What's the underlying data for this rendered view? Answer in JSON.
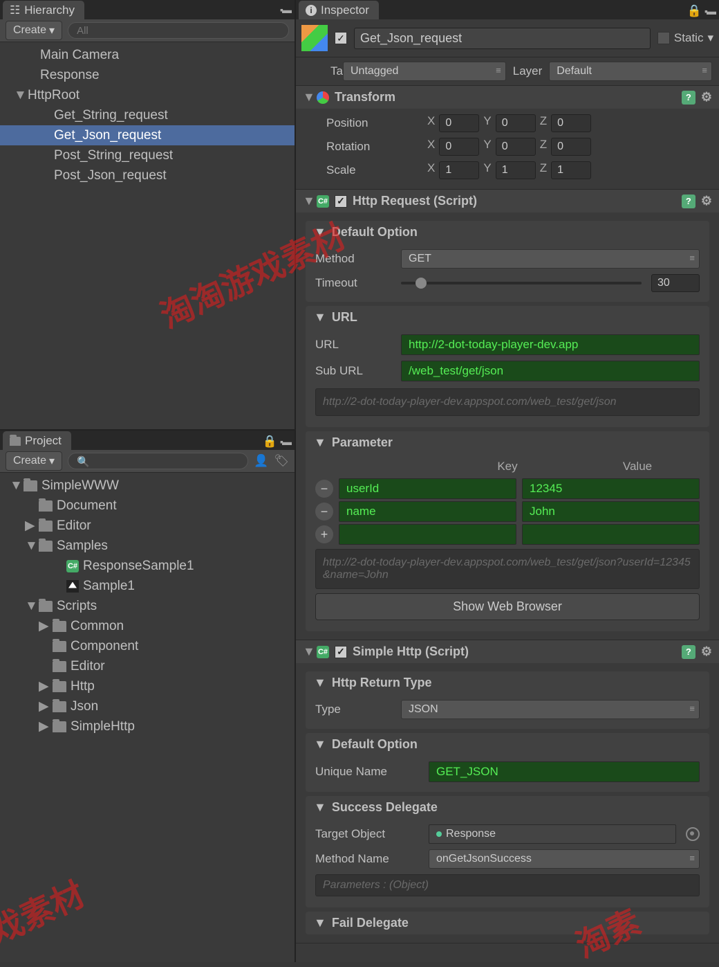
{
  "hierarchy": {
    "tab_label": "Hierarchy",
    "create_label": "Create",
    "search_placeholder": "All",
    "items": [
      {
        "label": "Main Camera",
        "indent": 1,
        "arrow": ""
      },
      {
        "label": "Response",
        "indent": 1,
        "arrow": ""
      },
      {
        "label": "HttpRoot",
        "indent": 0,
        "arrow": "▼"
      },
      {
        "label": "Get_String_request",
        "indent": 2,
        "arrow": ""
      },
      {
        "label": "Get_Json_request",
        "indent": 2,
        "arrow": "",
        "selected": true
      },
      {
        "label": "Post_String_request",
        "indent": 2,
        "arrow": ""
      },
      {
        "label": "Post_Json_request",
        "indent": 2,
        "arrow": ""
      }
    ]
  },
  "project": {
    "tab_label": "Project",
    "create_label": "Create",
    "items": [
      {
        "label": "SimpleWWW",
        "indent": 1,
        "arrow": "▼",
        "icon": "folder"
      },
      {
        "label": "Document",
        "indent": 2,
        "arrow": "",
        "icon": "folder"
      },
      {
        "label": "Editor",
        "indent": 2,
        "arrow": "▶",
        "icon": "folder"
      },
      {
        "label": "Samples",
        "indent": 2,
        "arrow": "▼",
        "icon": "folder"
      },
      {
        "label": "ResponseSample1",
        "indent": 4,
        "arrow": "",
        "icon": "cs"
      },
      {
        "label": "Sample1",
        "indent": 4,
        "arrow": "",
        "icon": "unity"
      },
      {
        "label": "Scripts",
        "indent": 2,
        "arrow": "▼",
        "icon": "folder"
      },
      {
        "label": "Common",
        "indent": 3,
        "arrow": "▶",
        "icon": "folder"
      },
      {
        "label": "Component",
        "indent": 3,
        "arrow": "",
        "icon": "folder"
      },
      {
        "label": "Editor",
        "indent": 3,
        "arrow": "",
        "icon": "folder"
      },
      {
        "label": "Http",
        "indent": 3,
        "arrow": "▶",
        "icon": "folder"
      },
      {
        "label": "Json",
        "indent": 3,
        "arrow": "▶",
        "icon": "folder"
      },
      {
        "label": "SimpleHttp",
        "indent": 3,
        "arrow": "▶",
        "icon": "folder"
      }
    ]
  },
  "inspector": {
    "tab_label": "Inspector",
    "object_name": "Get_Json_request",
    "static_label": "Static",
    "tag_label": "Tag",
    "tag_value": "Untagged",
    "layer_label": "Layer",
    "layer_value": "Default",
    "transform": {
      "title": "Transform",
      "position_label": "Position",
      "position": {
        "x": "0",
        "y": "0",
        "z": "0"
      },
      "rotation_label": "Rotation",
      "rotation": {
        "x": "0",
        "y": "0",
        "z": "0"
      },
      "scale_label": "Scale",
      "scale": {
        "x": "1",
        "y": "1",
        "z": "1"
      }
    },
    "http_request": {
      "title": "Http Request (Script)",
      "default_option": {
        "title": "Default Option",
        "method_label": "Method",
        "method_value": "GET",
        "timeout_label": "Timeout",
        "timeout_value": "30"
      },
      "url_section": {
        "title": "URL",
        "url_label": "URL",
        "url_value": "http://2-dot-today-player-dev.app",
        "suburl_label": "Sub URL",
        "suburl_value": "/web_test/get/json",
        "helper": "http://2-dot-today-player-dev.appspot.com/web_test/get/json"
      },
      "parameter": {
        "title": "Parameter",
        "key_header": "Key",
        "value_header": "Value",
        "rows": [
          {
            "key": "userId",
            "value": "12345"
          },
          {
            "key": "name",
            "value": "John"
          }
        ],
        "helper": "http://2-dot-today-player-dev.appspot.com/web_test/get/json?userId=12345&name=John",
        "button": "Show Web Browser"
      }
    },
    "simple_http": {
      "title": "Simple Http (Script)",
      "return_type": {
        "title": "Http Return Type",
        "type_label": "Type",
        "type_value": "JSON"
      },
      "default_option": {
        "title": "Default Option",
        "unique_label": "Unique Name",
        "unique_value": "GET_JSON"
      },
      "success": {
        "title": "Success Delegate",
        "target_label": "Target Object",
        "target_value": "Response",
        "method_label": "Method Name",
        "method_value": "onGetJsonSuccess",
        "params": "Parameters : (Object)"
      },
      "fail": {
        "title": "Fail Delegate"
      }
    }
  },
  "watermark": "淘淘游戏素材"
}
